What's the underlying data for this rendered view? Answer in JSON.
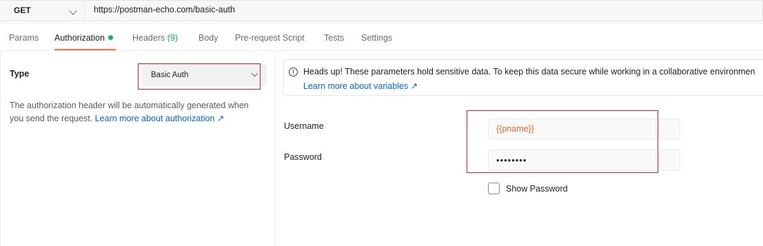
{
  "request": {
    "method": "GET",
    "url": "https://postman-echo.com/basic-auth"
  },
  "tabs": [
    {
      "label": "Params"
    },
    {
      "label": "Authorization",
      "active": true
    },
    {
      "label": "Headers",
      "count": "(9)"
    },
    {
      "label": "Body"
    },
    {
      "label": "Pre-request Script"
    },
    {
      "label": "Tests"
    },
    {
      "label": "Settings"
    }
  ],
  "auth": {
    "type_label": "Type",
    "type_value": "Basic Auth",
    "description": "The authorization header will be automatically generated when you send the request.",
    "description_link": "Learn more about authorization ↗"
  },
  "notice": {
    "text": "Heads up! These parameters hold sensitive data. To keep this data secure while working in a collaborative environmen",
    "link": "Learn more about variables ↗"
  },
  "fields": {
    "username_label": "Username",
    "username_value": "{{pname}}",
    "password_label": "Password",
    "password_value": "••••••••",
    "show_password_label": "Show Password"
  },
  "colors": {
    "accent": "#ff6c37",
    "success": "#0cbb52",
    "link": "#0265d2",
    "variable": "#e8632e",
    "highlight": "#c0262c"
  }
}
